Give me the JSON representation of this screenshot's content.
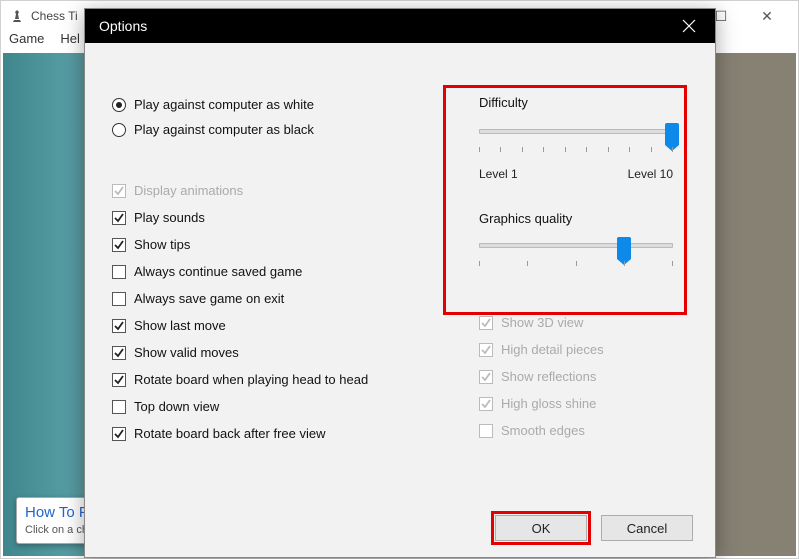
{
  "app": {
    "title": "Chess Ti",
    "menu": {
      "game": "Game",
      "help": "Hel"
    }
  },
  "tooltip": {
    "title": "How To Pla",
    "body": "Click on a che\nmove it to wil\nsquare to mo"
  },
  "dialog": {
    "title": "Options",
    "radios": {
      "white": "Play against computer as white",
      "black": "Play against computer as black",
      "selected": "white"
    },
    "checks": {
      "display_animations": {
        "label": "Display animations",
        "checked": true,
        "disabled": true
      },
      "play_sounds": {
        "label": "Play sounds",
        "checked": true
      },
      "show_tips": {
        "label": "Show tips",
        "checked": true
      },
      "always_continue_saved": {
        "label": "Always continue saved game",
        "checked": false
      },
      "always_save_exit": {
        "label": "Always save game on exit",
        "checked": false
      },
      "show_last_move": {
        "label": "Show last move",
        "checked": true
      },
      "show_valid_moves": {
        "label": "Show valid moves",
        "checked": true
      },
      "rotate_head_to_head": {
        "label": "Rotate board when playing head to head",
        "checked": true
      },
      "top_down_view": {
        "label": "Top down view",
        "checked": false
      },
      "rotate_after_free": {
        "label": "Rotate board back after free view",
        "checked": true
      }
    },
    "difficulty": {
      "label": "Difficulty",
      "min_label": "Level 1",
      "max_label": "Level 10",
      "value": 10,
      "min": 1,
      "max": 10
    },
    "graphics": {
      "label": "Graphics quality",
      "value": 4,
      "min": 1,
      "max": 5
    },
    "gfx_checks": {
      "show_3d": {
        "label": "Show 3D view",
        "checked": true,
        "disabled": true
      },
      "high_detail": {
        "label": "High detail pieces",
        "checked": true,
        "disabled": true
      },
      "reflections": {
        "label": "Show reflections",
        "checked": true,
        "disabled": true
      },
      "gloss": {
        "label": "High gloss shine",
        "checked": true,
        "disabled": true
      },
      "smooth": {
        "label": "Smooth edges",
        "checked": false,
        "disabled": true
      }
    },
    "buttons": {
      "ok": "OK",
      "cancel": "Cancel"
    }
  }
}
